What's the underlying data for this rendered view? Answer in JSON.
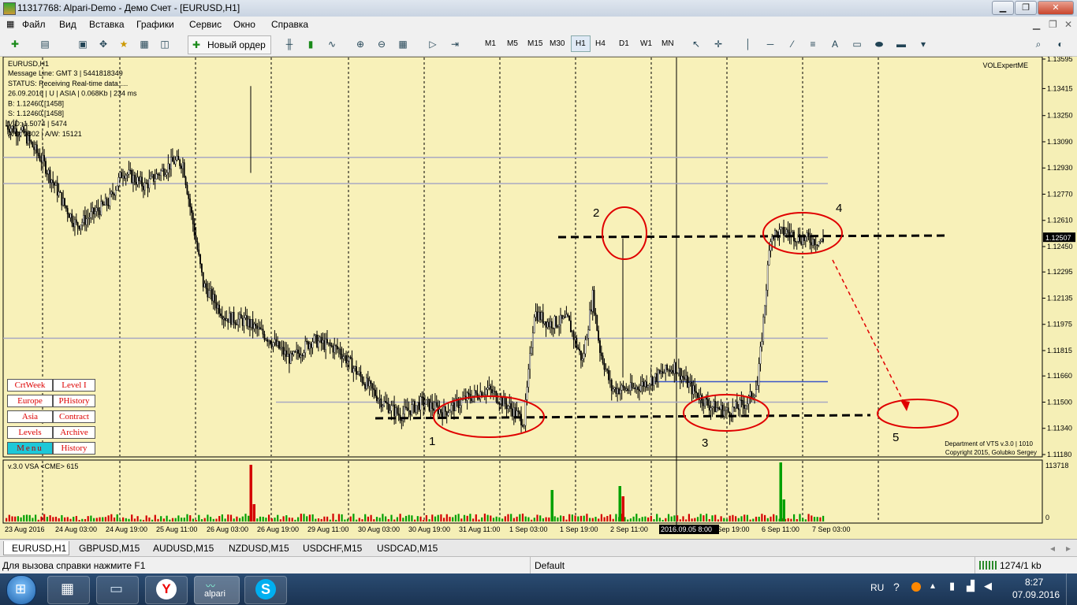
{
  "window": {
    "title": "11317768: Alpari-Demo - Демо Счет - [EURUSD,H1]",
    "btn_min": "▁",
    "btn_max": "❐",
    "btn_close": "✕"
  },
  "menu": [
    "Файл",
    "Вид",
    "Вставка",
    "Графики",
    "Сервис",
    "Окно",
    "Справка"
  ],
  "toolbar": {
    "new_order": "Новый ордер",
    "timeframes": [
      "M1",
      "M5",
      "M15",
      "M30",
      "H1",
      "H4",
      "D1",
      "W1",
      "MN"
    ],
    "active_timeframe": "H1"
  },
  "chart": {
    "symbol": "EURUSD,H1",
    "info_lines": [
      "Message Line: GMT 3 | 5441818349",
      "STATUS:  Receiving Real-time data.....",
      "26.09.2016 | U | ASIA | 0.068Kb | 234 ms",
      "B: 1.12460  [1458]",
      "S: 1.12460  [1458]",
      "VID: 1.5074 | 5474",
      "A/D: 2802 | A/W: 15121"
    ],
    "expert": "VOLExpertME",
    "copyright": [
      "Department of VTS  v.3.0 | 1010",
      "Copyright 2015, Golubko Sergey"
    ],
    "indicator_label": "v.3.0 VSA <CME> 615",
    "indicator_max": "113718",
    "indicator_zero": "0",
    "price_axis": [
      "1.13595",
      "1.13415",
      "1.13250",
      "1.13090",
      "1.12930",
      "1.12770",
      "1.12610",
      "1.12507",
      "1.12450",
      "1.12295",
      "1.12135",
      "1.11975",
      "1.11815",
      "1.11660",
      "1.11500",
      "1.11340",
      "1.11180"
    ],
    "current_price": "1.12507",
    "time_axis": [
      "23 Aug 2016",
      "24 Aug 03:00",
      "24 Aug 19:00",
      "25 Aug 11:00",
      "26 Aug 03:00",
      "26 Aug 19:00",
      "29 Aug 11:00",
      "30 Aug 03:00",
      "30 Aug 19:00",
      "31 Aug 11:00",
      "1 Sep 03:00",
      "1 Sep 19:00",
      "2 Sep 11:00",
      "2016.09.05 8:00",
      "5 Sep 19:00",
      "6 Sep 11:00",
      "7 Sep 03:00"
    ],
    "annotations": [
      "1",
      "2",
      "3",
      "4",
      "5"
    ],
    "buttons_left": [
      "CrtWeek",
      "Europe",
      "Asia",
      "Levels",
      "Menu"
    ],
    "buttons_right": [
      "Level I",
      "PHistory",
      "Contract",
      "Archive",
      "History"
    ]
  },
  "tabs": [
    "EURUSD,H1",
    "GBPUSD,M15",
    "AUDUSD,M15",
    "NZDUSD,M15",
    "USDCHF,M15",
    "USDCAD,M15"
  ],
  "status": {
    "help": "Для вызова справки нажмите F1",
    "profile": "Default",
    "traffic": "1274/1 kb"
  },
  "taskbar": {
    "lang": "RU",
    "time": "8:27",
    "date": "07.09.2016",
    "alpari_label": "alpari"
  },
  "colors": {
    "chart_bg": "#f5efb6",
    "bull": "#00a000",
    "bear": "#d40000",
    "annotation": "#e00000"
  }
}
